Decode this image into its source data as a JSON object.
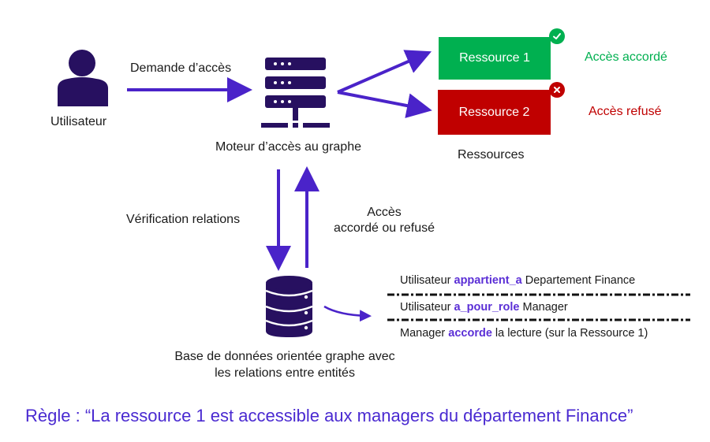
{
  "colors": {
    "arrow": "#4a23c9",
    "icon": "#271060",
    "granted": "#00b050",
    "denied": "#c00000",
    "keyword": "#5b2fd6",
    "rule": "#4a2ad1"
  },
  "user": {
    "icon": "user-icon",
    "label": "Utilisateur"
  },
  "request_arrow": {
    "label": "Demande d’accès"
  },
  "engine": {
    "icon": "server-icon",
    "label": "Moteur d’accès au graphe"
  },
  "resources": {
    "title": "Ressources",
    "items": [
      {
        "label": "Ressource 1",
        "status_icon": "check-icon",
        "status": "Accès accordé"
      },
      {
        "label": "Ressource 2",
        "status_icon": "cross-icon",
        "status": "Accès refusé"
      }
    ]
  },
  "verification": {
    "down_label": "Vérification relations",
    "up_label_line1": "Accès",
    "up_label_line2": "accordé ou refusé"
  },
  "database": {
    "icon": "database-icon",
    "label_line1": "Base de données orientée graphe avec",
    "label_line2": "les relations entre entités"
  },
  "relations": [
    {
      "subject": "Utilisateur",
      "predicate": "appartient_a",
      "object": "Departement Finance"
    },
    {
      "subject": "Utilisateur ",
      "predicate": "a_pour_role",
      "object": "Manager"
    },
    {
      "subject": "Manager",
      "predicate": "accorde",
      "object": "la lecture (sur la Ressource 1)"
    }
  ],
  "rule": {
    "text": "Règle : “La ressource 1 est accessible aux managers du département Finance”"
  }
}
